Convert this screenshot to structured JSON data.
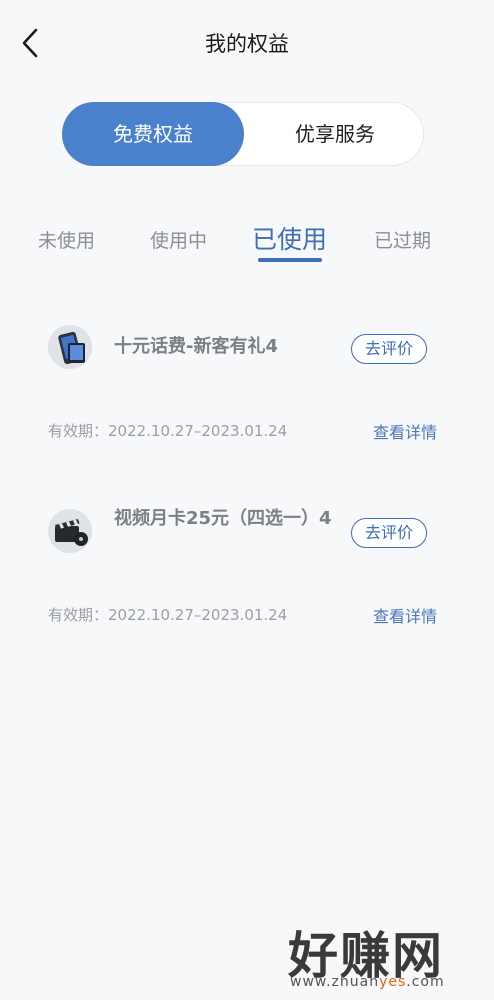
{
  "header": {
    "title": "我的权益",
    "back_icon": "chevron-left-icon"
  },
  "segment": {
    "options": [
      "免费权益",
      "优享服务"
    ],
    "selected": "免费权益",
    "active_color": "#4a80cc"
  },
  "tabs": {
    "items": [
      "未使用",
      "使用中",
      "已使用",
      "已过期"
    ],
    "selected": "已使用",
    "active_color": "#3c6fb7"
  },
  "benefits": [
    {
      "icon": "phone-icon",
      "title": "十元话费-新客有礼4",
      "action_label": "去评价",
      "validity": "有效期：2022.10.27–2023.01.24",
      "detail_label": "查看详情"
    },
    {
      "icon": "film-icon",
      "title": "视频月卡25元（四选一）4",
      "action_label": "去评价",
      "validity": "有效期：2022.10.27–2023.01.24",
      "detail_label": "查看详情"
    }
  ],
  "watermark": {
    "brand": "好赚网",
    "domain_prefix": "www.zhuan",
    "domain_highlight": "yes",
    "domain_suffix": ".com"
  }
}
